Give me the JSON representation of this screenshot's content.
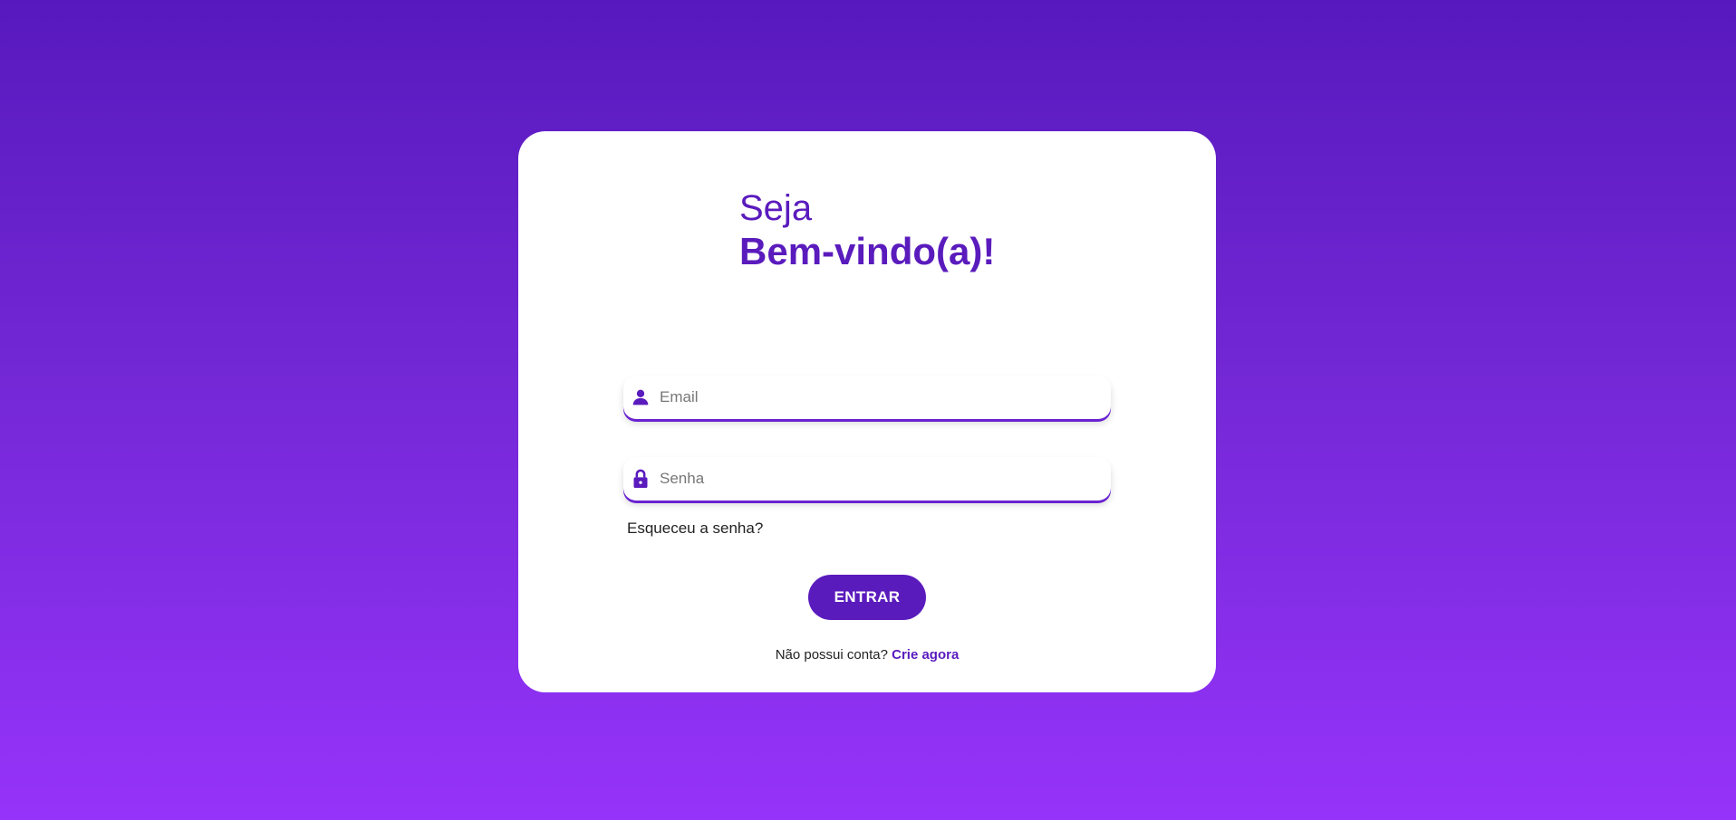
{
  "greeting": {
    "line1": "Seja",
    "line2": "Bem-vindo(a)!"
  },
  "form": {
    "email": {
      "icon": "user-icon",
      "placeholder": "Email",
      "value": ""
    },
    "password": {
      "icon": "lock-icon",
      "placeholder": "Senha",
      "value": ""
    },
    "forgot_label": "Esqueceu a senha?",
    "submit_label": "ENTRAR"
  },
  "signup": {
    "prompt": "Não possui conta?",
    "link_label": "Crie agora"
  },
  "colors": {
    "accent": "#5a1bbd",
    "background_top": "#5719bd",
    "background_bottom": "#9633fa",
    "card": "#ffffff"
  }
}
